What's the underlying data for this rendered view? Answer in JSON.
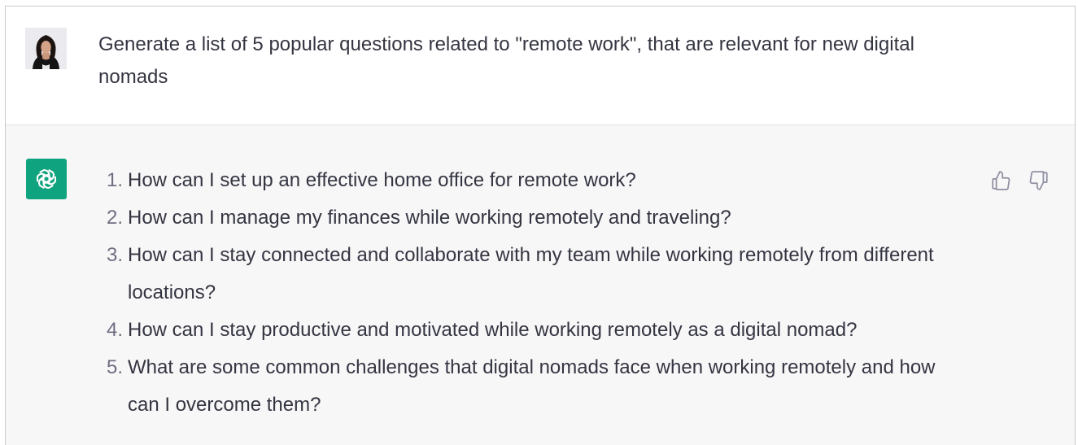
{
  "user_message": {
    "text": "Generate a list of 5 popular questions related to \"remote work\", that are relevant for new digital nomads",
    "avatar_icon": "user-avatar-photo"
  },
  "assistant_message": {
    "logo_icon": "openai-logo-icon",
    "items": [
      {
        "num": "1.",
        "text": "How can I set up an effective home office for remote work?"
      },
      {
        "num": "2.",
        "text": "How can I manage my finances while working remotely and traveling?"
      },
      {
        "num": "3.",
        "text": "How can I stay connected and collaborate with my team while working remotely from different locations?"
      },
      {
        "num": "4.",
        "text": "How can I stay productive and motivated while working remotely as a digital nomad?"
      },
      {
        "num": "5.",
        "text": "What are some common challenges that digital nomads face when working remotely and how can I overcome them?"
      }
    ],
    "feedback": {
      "thumbs_up_icon": "thumbs-up-icon",
      "thumbs_down_icon": "thumbs-down-icon"
    }
  },
  "colors": {
    "assistant_bg": "#f7f7f8",
    "user_bg": "#ffffff",
    "brand_green": "#10a37f",
    "text": "#343541",
    "muted": "#6e6e80"
  }
}
